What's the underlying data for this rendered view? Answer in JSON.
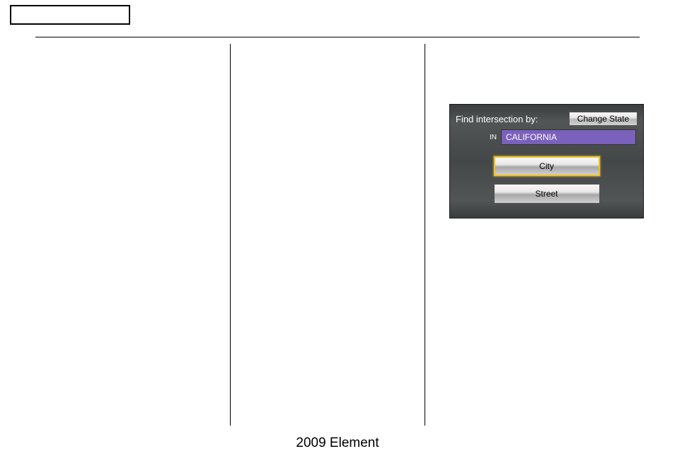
{
  "footer": "2009  Element",
  "nav": {
    "title": "Find intersection by:",
    "change_state_label": "Change State",
    "in_label": "IN",
    "state_value": "CALIFORNIA",
    "city_label": "City",
    "street_label": "Street"
  }
}
